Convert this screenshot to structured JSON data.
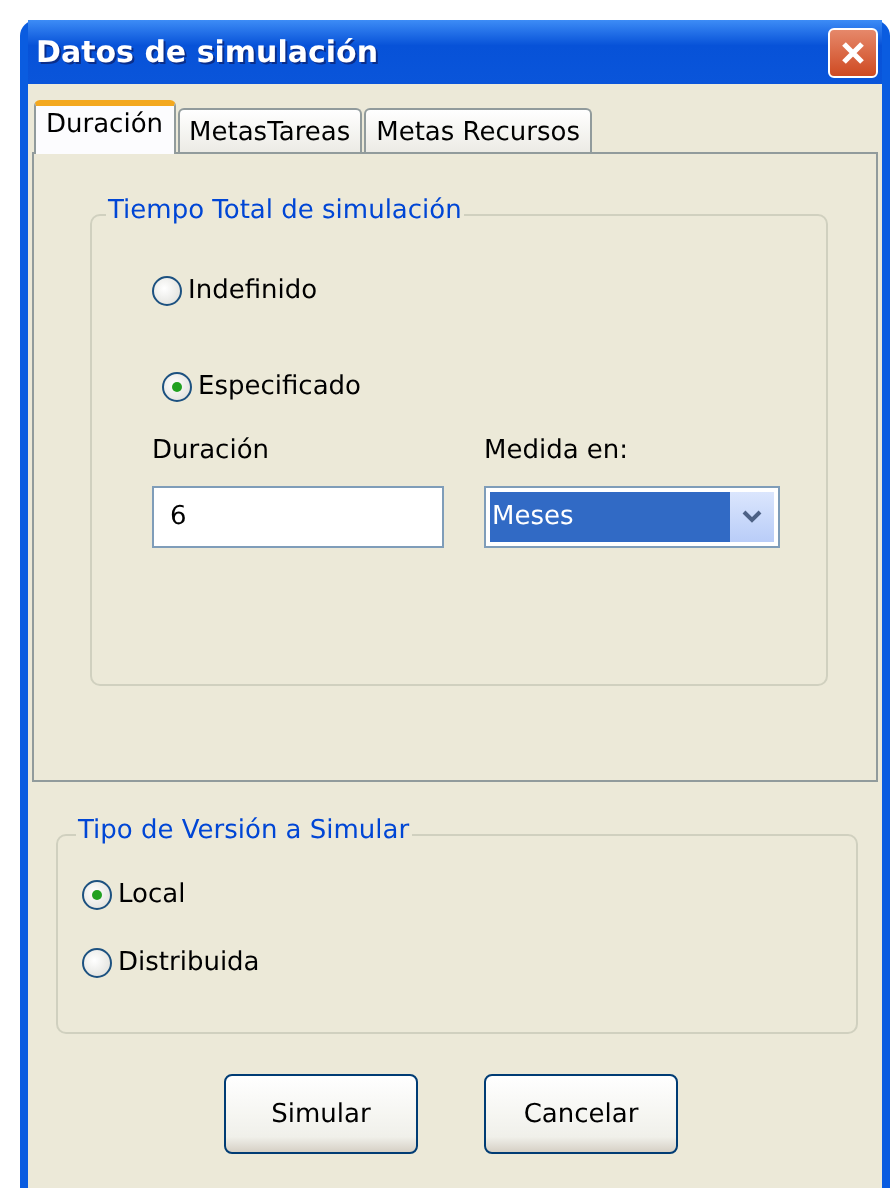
{
  "window": {
    "title": "Datos de simulación"
  },
  "tabs": [
    {
      "label": "Duración",
      "selected": true
    },
    {
      "label": "MetasTareas",
      "selected": false
    },
    {
      "label": "Metas Recursos",
      "selected": false
    }
  ],
  "time_group": {
    "title": "Tiempo Total de simulación",
    "options": [
      {
        "label": "Indefinido",
        "selected": false
      },
      {
        "label": "Especificado",
        "selected": true
      }
    ],
    "duration": {
      "label": "Duración",
      "value": "6"
    },
    "measure": {
      "label": "Medida en:",
      "value": "Meses"
    }
  },
  "version_group": {
    "title": "Tipo de Versión a Simular",
    "options": [
      {
        "label": "Local",
        "selected": true
      },
      {
        "label": "Distribuida",
        "selected": false
      }
    ]
  },
  "buttons": [
    "Simular",
    "Cancelar"
  ]
}
